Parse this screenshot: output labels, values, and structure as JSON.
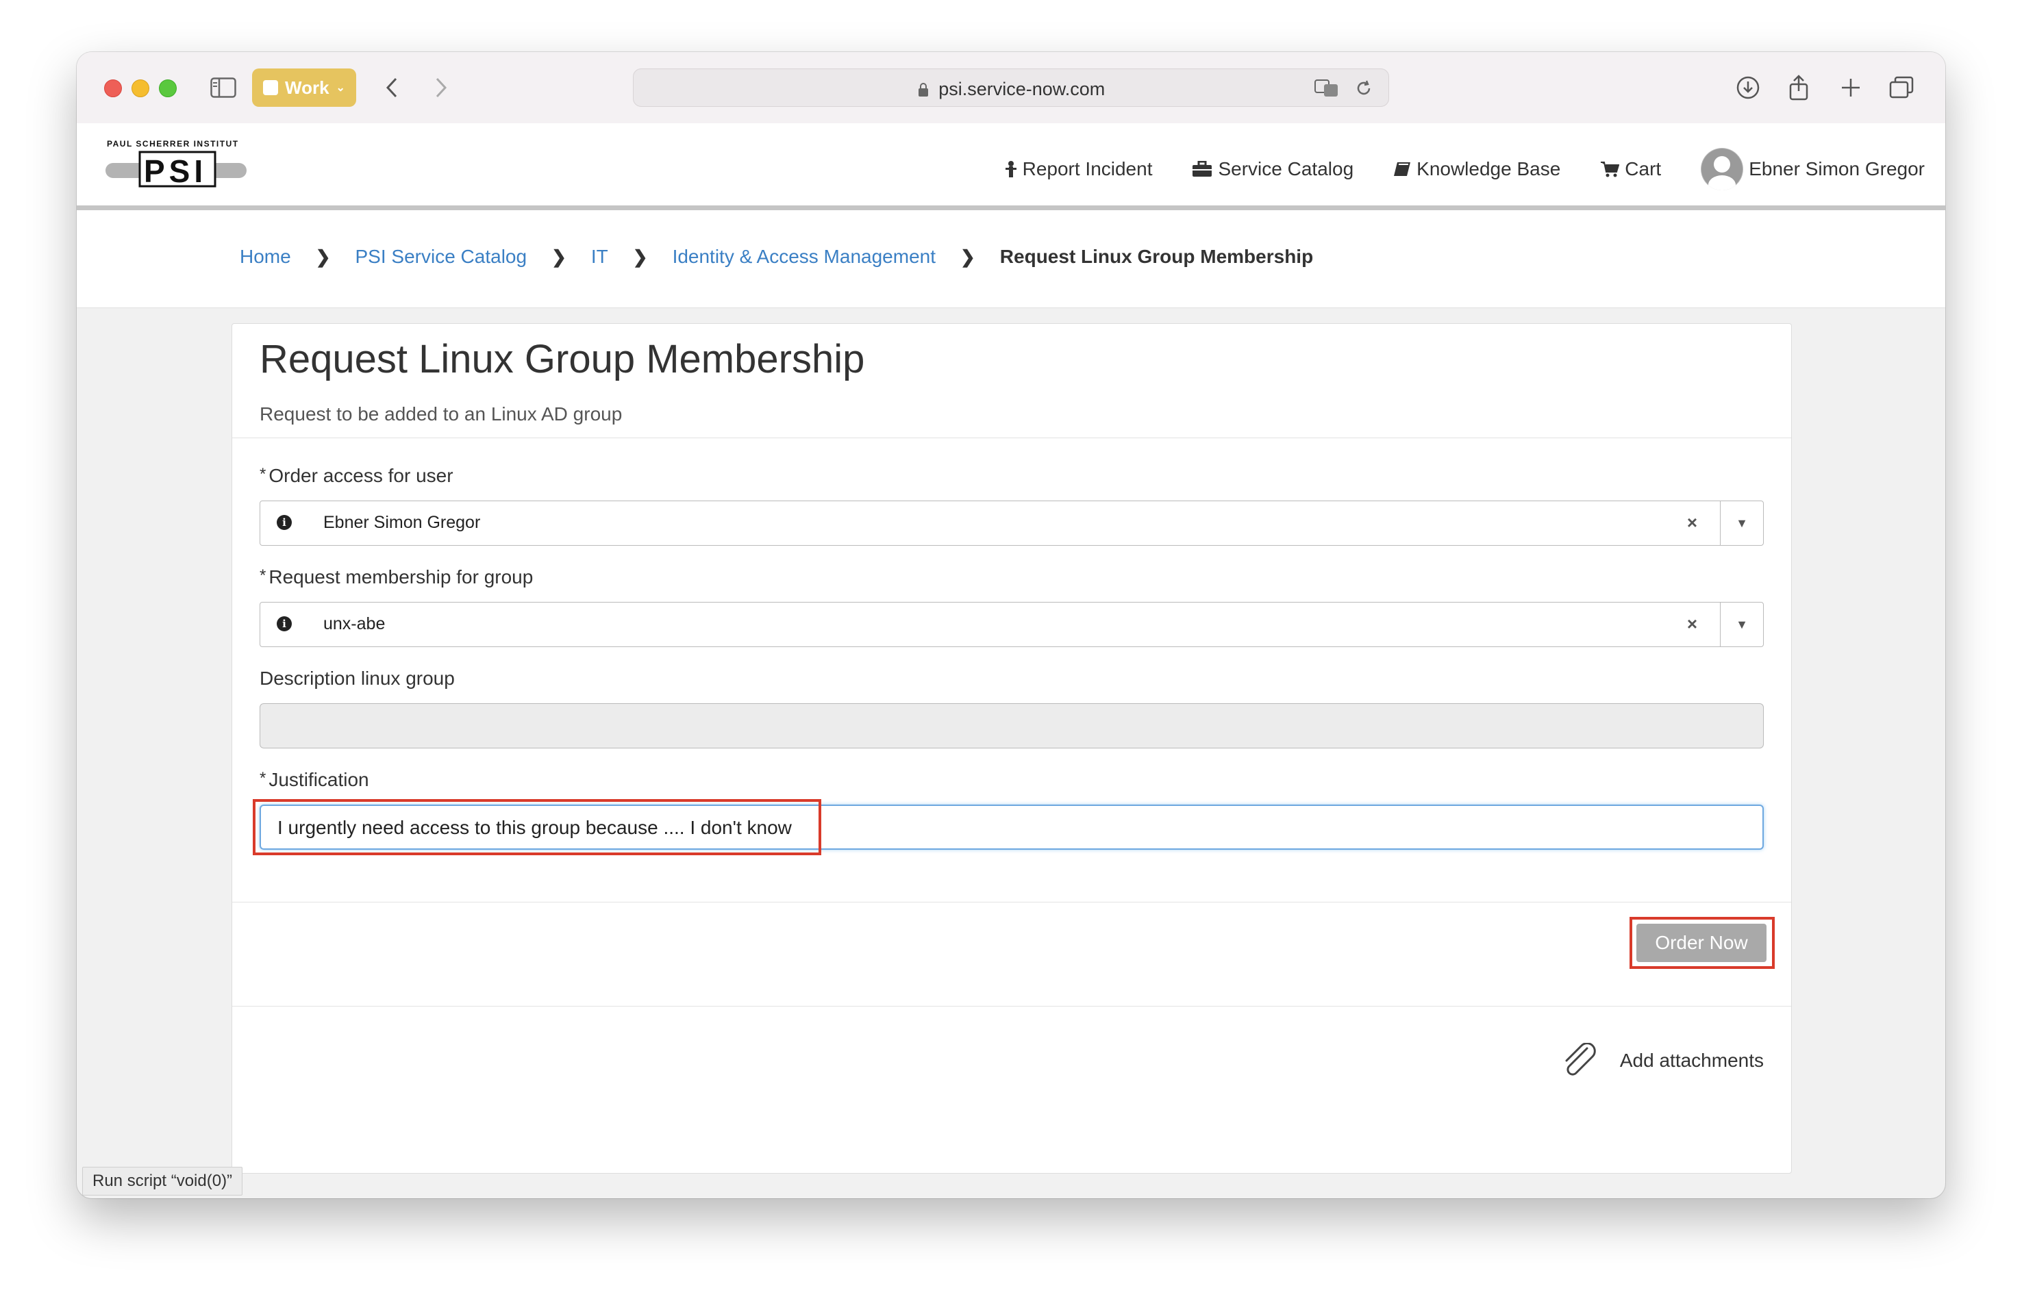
{
  "browser": {
    "workspace_label": "Work",
    "url": "psi.service-now.com"
  },
  "site": {
    "logo_text": "PAUL SCHERRER INSTITUT",
    "nav": {
      "report_incident": "Report Incident",
      "service_catalog": "Service Catalog",
      "knowledge_base": "Knowledge Base",
      "cart": "Cart",
      "user_name": "Ebner Simon Gregor"
    }
  },
  "breadcrumb": {
    "items": [
      "Home",
      "PSI Service Catalog",
      "IT",
      "Identity & Access Management"
    ],
    "current": "Request Linux Group Membership"
  },
  "form": {
    "title": "Request Linux Group Membership",
    "subtitle": "Request to be added to an Linux AD group",
    "fields": {
      "order_user_label": "Order access for user",
      "order_user_value": "Ebner Simon Gregor",
      "group_label": "Request membership for group",
      "group_value": "unx-abe",
      "description_label": "Description linux group",
      "description_value": "",
      "justification_label": "Justification",
      "justification_value": "I urgently need access to this group because .... I don't know"
    },
    "required_mark": "*",
    "order_button": "Order Now",
    "attachments_label": "Add attachments"
  },
  "status_bar": "Run script “void(0)”",
  "colors": {
    "link": "#3a7fc4",
    "highlight": "#d93b2b",
    "button": "#a9a9a9",
    "focus": "#6ea8e0"
  }
}
